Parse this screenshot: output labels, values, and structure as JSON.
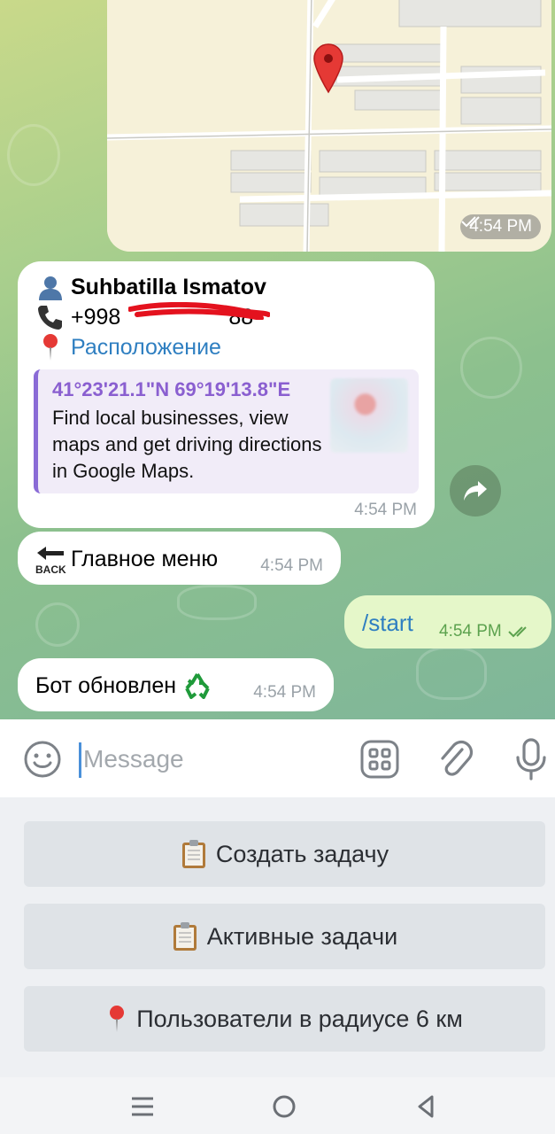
{
  "map_message": {
    "time": "4:54 PM"
  },
  "contact_message": {
    "name": "Suhbatilla Ismatov",
    "phone": "+998",
    "phone_tail": "88",
    "location_link": "Расположение",
    "preview_title": "41°23'21.1\"N 69°19'13.8\"E",
    "preview_description": "Find local businesses, view maps and get driving directions in Google Maps.",
    "time": "4:54 PM",
    "icons": [
      "person-icon",
      "phone-icon",
      "pin-icon"
    ]
  },
  "menu_message": {
    "text": "Главное меню",
    "time": "4:54 PM",
    "icon": "back-arrow-icon"
  },
  "start_message": {
    "text": "/start",
    "time": "4:54 PM"
  },
  "bot_message": {
    "text": "Бот обновлен",
    "time": "4:54 PM",
    "icon": "recycle-icon"
  },
  "input_bar": {
    "placeholder": "Message"
  },
  "keyboard": {
    "buttons": [
      {
        "label": "Создать задачу",
        "icon": "clipboard-icon"
      },
      {
        "label": "Активные задачи",
        "icon": "clipboard-icon"
      },
      {
        "label": "Пользователи в радиусе 6 км",
        "icon": "pin-icon"
      }
    ]
  },
  "colors": {
    "bubble_out": "#e5f7c9",
    "link": "#2f7fc1",
    "preview_accent": "#8a6bd6"
  }
}
